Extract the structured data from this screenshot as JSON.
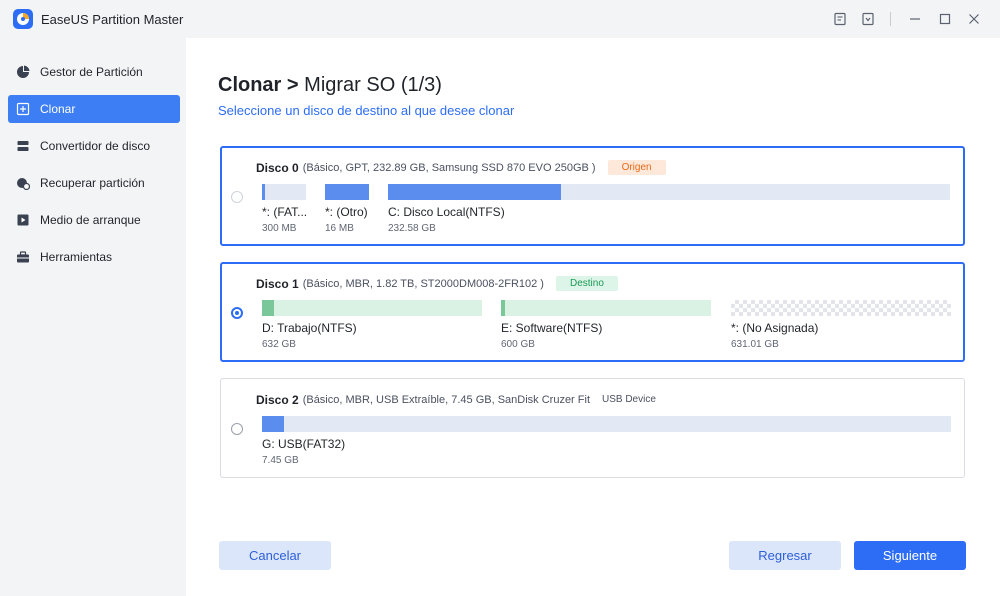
{
  "app": {
    "title": "EaseUS Partition Master"
  },
  "sidebar": {
    "items": [
      {
        "label": "Gestor de Partición",
        "icon": "pie-chart-icon"
      },
      {
        "label": "Clonar",
        "icon": "clone-icon"
      },
      {
        "label": "Convertidor de disco",
        "icon": "disk-converter-icon"
      },
      {
        "label": "Recuperar partición",
        "icon": "recover-icon"
      },
      {
        "label": "Medio de arranque",
        "icon": "boot-media-icon"
      },
      {
        "label": "Herramientas",
        "icon": "toolbox-icon"
      }
    ],
    "active": "Clonar"
  },
  "header": {
    "crumb_main": "Clonar",
    "crumb_sep": ">",
    "crumb_sub": "Migrar SO (1/3)",
    "subtitle": "Seleccione un disco de destino al que desee clonar"
  },
  "disks": [
    {
      "name": "Disco 0",
      "info": "(Básico, GPT, 232.89 GB, Samsung SSD 870 EVO 250GB )",
      "tag": "Origen",
      "selected": false,
      "partitions": [
        {
          "label": "*: (FAT...",
          "size": "300 MB",
          "fill": 0.1
        },
        {
          "label": "*: (Otro)",
          "size": "16 MB",
          "fill": 1.0
        },
        {
          "label": "C: Disco Local(NTFS)",
          "size": "232.58 GB",
          "fill": 0.3
        }
      ]
    },
    {
      "name": "Disco 1",
      "info": "(Básico, MBR, 1.82 TB, ST2000DM008-2FR102 )",
      "tag": "Destino",
      "selected": true,
      "partitions": [
        {
          "label": "D: Trabajo(NTFS)",
          "size": "632 GB",
          "fill": 0.06
        },
        {
          "label": "E: Software(NTFS)",
          "size": "600 GB",
          "fill": 0.02
        },
        {
          "label": "*: (No Asignada)",
          "size": "631.01 GB",
          "fill": 0
        }
      ]
    },
    {
      "name": "Disco 2",
      "info": "(Básico, MBR, USB Extraíble, 7.45 GB, SanDisk  Cruzer Fit",
      "tag": "USB Device",
      "selected": false,
      "partitions": [
        {
          "label": "G: USB(FAT32)",
          "size": "7.45 GB",
          "fill": 0.03
        }
      ]
    }
  ],
  "buttons": {
    "cancel": "Cancelar",
    "back": "Regresar",
    "next": "Siguiente"
  },
  "colors": {
    "accent": "#2d6df6",
    "bar_blue": "#5b8def",
    "bar_green": "#7ac79a",
    "tag_origin": "#e76b1b",
    "tag_dest": "#1a9a55"
  }
}
